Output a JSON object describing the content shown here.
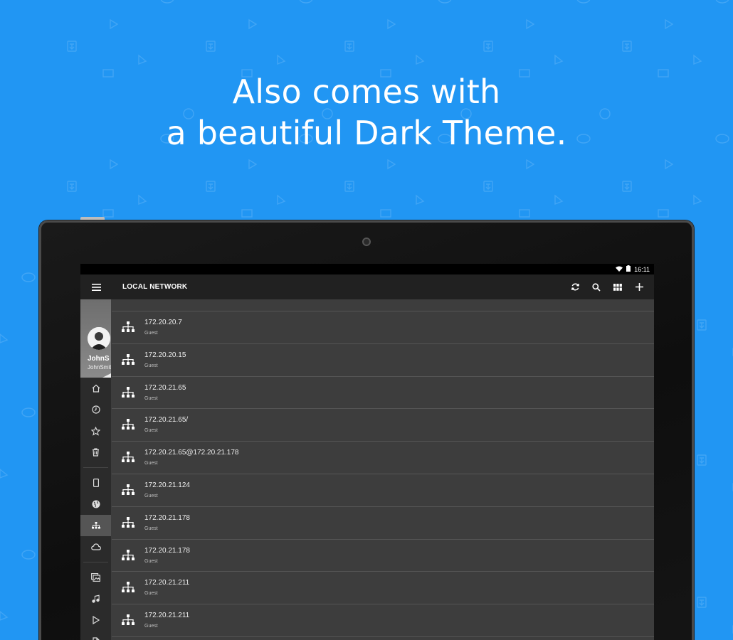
{
  "headline": {
    "line1": "Also comes with",
    "line2": "a beautiful Dark Theme."
  },
  "colors": {
    "background": "#2196f3",
    "toolbar": "#212121",
    "list_bg": "#3d3d3d",
    "sidebar_bg": "#2b2b2b"
  },
  "status_bar": {
    "time": "16:11",
    "icons": [
      "wifi-icon",
      "battery-icon"
    ]
  },
  "toolbar": {
    "title": "LOCAL NETWORK",
    "menu_icon": "hamburger-menu-icon",
    "actions": [
      "refresh-icon",
      "search-icon",
      "grid-view-icon",
      "add-icon"
    ]
  },
  "profile": {
    "name": "JohnS",
    "email": "JohnSmit"
  },
  "sidebar": {
    "items": [
      {
        "icon": "home-icon"
      },
      {
        "icon": "clock-icon"
      },
      {
        "icon": "star-icon"
      },
      {
        "icon": "trash-icon"
      },
      {
        "icon": "phone-icon"
      },
      {
        "icon": "globe-icon"
      },
      {
        "icon": "network-icon",
        "active": true
      },
      {
        "icon": "cloud-icon"
      },
      {
        "icon": "images-icon"
      },
      {
        "icon": "music-icon"
      },
      {
        "icon": "video-play-icon"
      },
      {
        "icon": "document-icon"
      }
    ]
  },
  "list": {
    "items": [
      {
        "name": "172.20.20.7",
        "sub": "Guest"
      },
      {
        "name": "172.20.20.15",
        "sub": "Guest"
      },
      {
        "name": "172.20.21.65",
        "sub": "Guest"
      },
      {
        "name": "172.20.21.65/",
        "sub": "Guest"
      },
      {
        "name": "172.20.21.65@172.20.21.178",
        "sub": "Guest"
      },
      {
        "name": "172.20.21.124",
        "sub": "Guest"
      },
      {
        "name": "172.20.21.178",
        "sub": "Guest"
      },
      {
        "name": "172.20.21.178",
        "sub": "Guest"
      },
      {
        "name": "172.20.21.211",
        "sub": "Guest"
      },
      {
        "name": "172.20.21.211",
        "sub": "Guest"
      }
    ]
  }
}
